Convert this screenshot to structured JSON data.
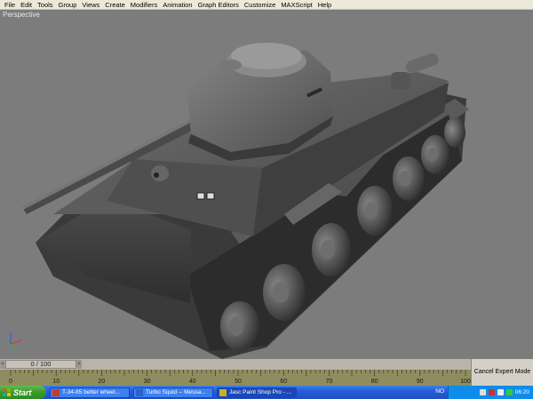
{
  "menubar": {
    "items": [
      "File",
      "Edit",
      "Tools",
      "Group",
      "Views",
      "Create",
      "Modifiers",
      "Animation",
      "Graph Editors",
      "Customize",
      "MAXScript",
      "Help"
    ]
  },
  "viewport": {
    "label": "Perspective",
    "axes": {
      "x": "x",
      "y": "y",
      "z": "z"
    }
  },
  "timeline": {
    "slider_label": "0 / 100",
    "ticks": [
      "0",
      "10",
      "20",
      "30",
      "40",
      "50",
      "60",
      "70",
      "80",
      "90",
      "100"
    ],
    "expert_mode": "Cancel Expert Mode"
  },
  "taskbar": {
    "start": "Start",
    "tasks": [
      {
        "label": "T-34-85 better wheel...",
        "icon_color": "#c83a2a"
      },
      {
        "label": "Turbo Squid -- Messa...",
        "icon_color": "#2a62c8"
      },
      {
        "label": "Jasc Paint Shop Pro - ...",
        "icon_color": "#c8b02a"
      }
    ],
    "language": "NO",
    "clock": "06:20"
  },
  "colors": {
    "viewport_bg": "#7c7c7c",
    "track": "#8f8d60",
    "taskbar": "#245edb",
    "start": "#3a9a2a"
  }
}
